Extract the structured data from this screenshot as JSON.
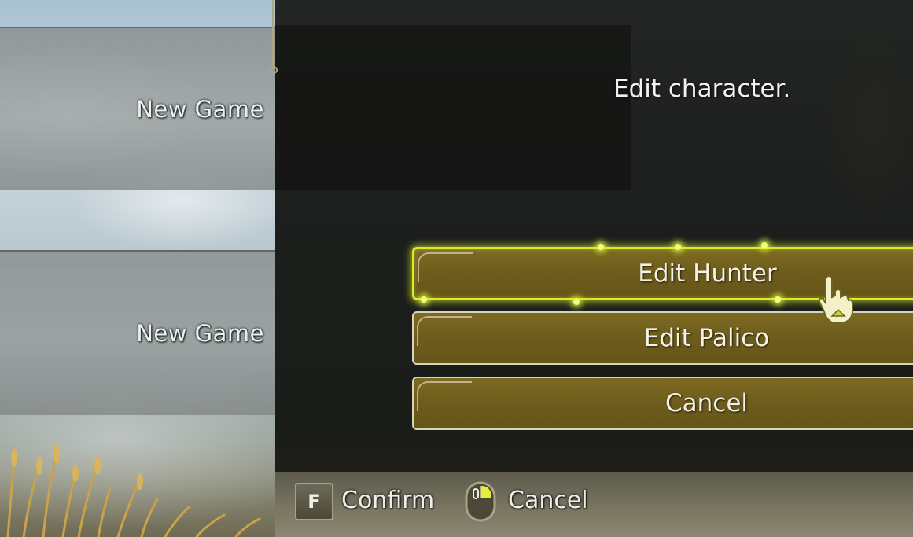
{
  "background_tiles": [
    {
      "label": "New Game"
    },
    {
      "label": "New Game"
    }
  ],
  "prompt": "Edit character.",
  "menu": {
    "items": [
      {
        "label": "Edit Hunter",
        "selected": true
      },
      {
        "label": "Edit Palico",
        "selected": false
      },
      {
        "label": "Cancel",
        "selected": false
      }
    ]
  },
  "controls": {
    "confirm_key": "F",
    "confirm_label": "Confirm",
    "cancel_icon": "mouse-right-click-icon",
    "cancel_label": "Cancel"
  },
  "colors": {
    "selection_glow": "#d7ec2a",
    "button_fill": "#6d5c1c",
    "button_border": "#d8d2bf"
  }
}
